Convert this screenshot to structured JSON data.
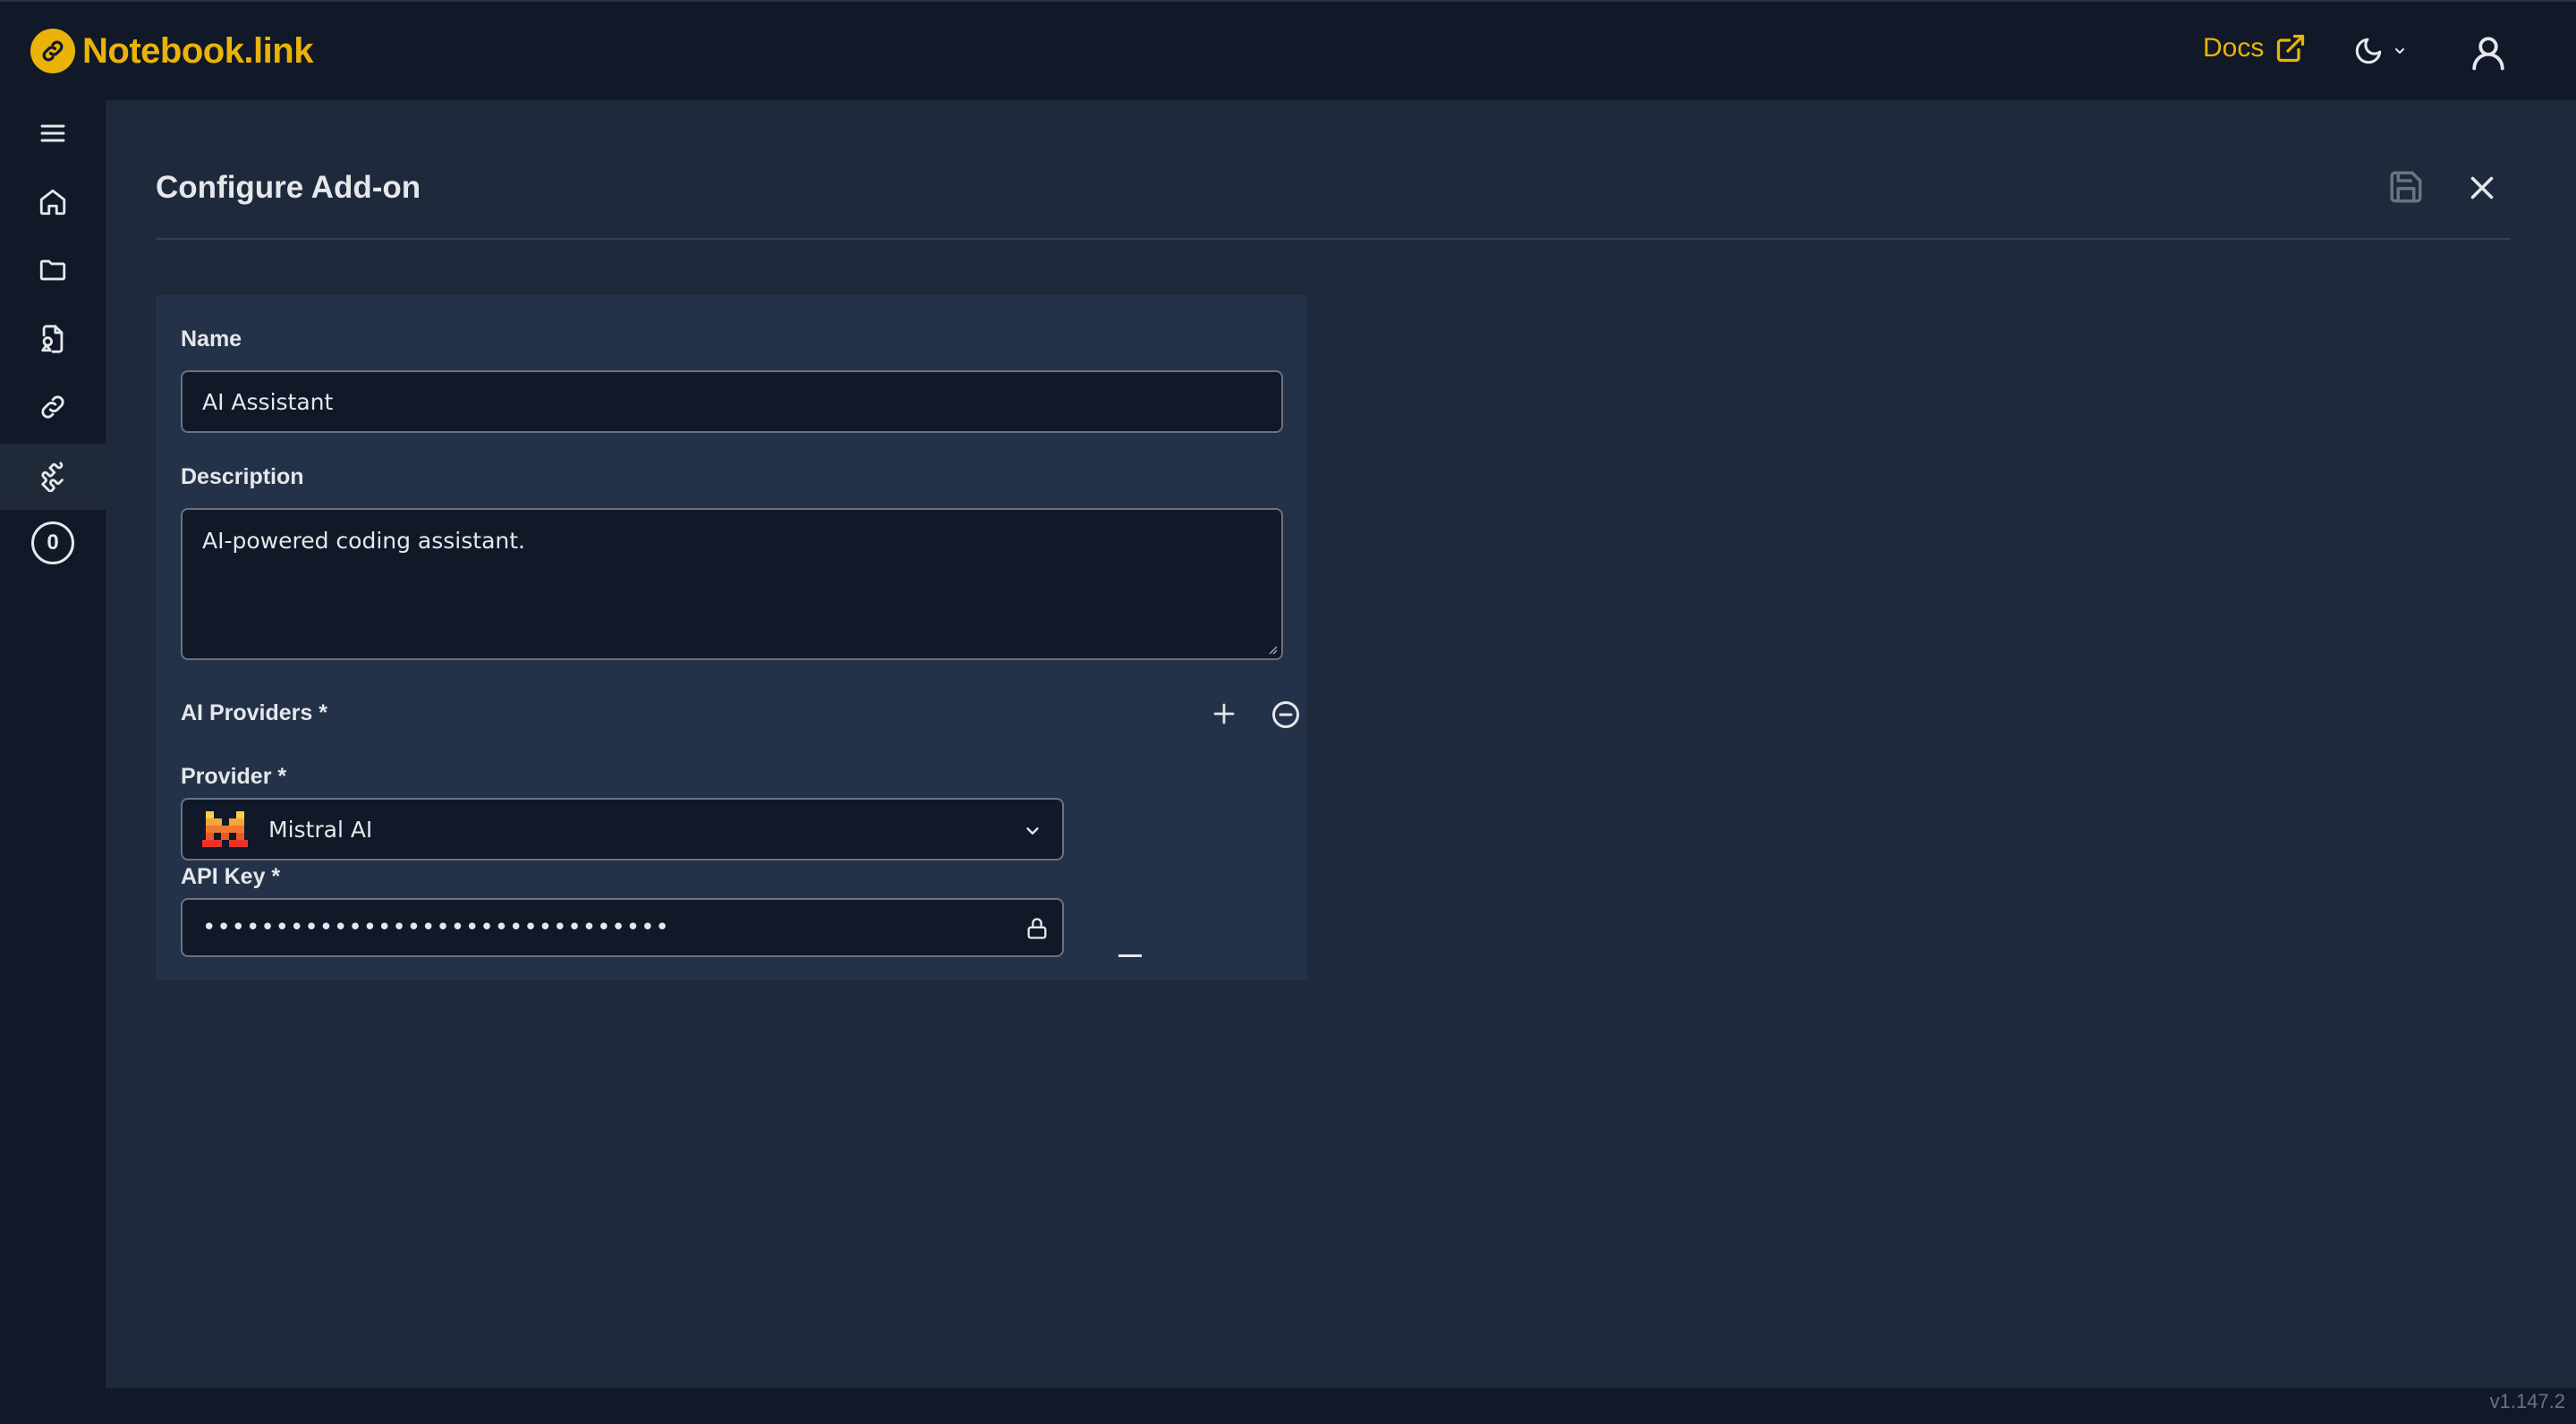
{
  "app": {
    "name": "Notebook.link",
    "version": "v1.147.2"
  },
  "header": {
    "docs_label": "Docs"
  },
  "page": {
    "title": "Configure Add-on"
  },
  "sidebar": {
    "items": [
      {
        "icon": "menu-icon"
      },
      {
        "icon": "home-icon"
      },
      {
        "icon": "folder-icon"
      },
      {
        "icon": "file-shapes-icon"
      },
      {
        "icon": "link-icon"
      },
      {
        "icon": "puzzle-icon",
        "active": true
      },
      {
        "icon": "counter-badge",
        "value": "0"
      }
    ]
  },
  "form": {
    "name_label": "Name",
    "name_value": "AI Assistant",
    "description_label": "Description",
    "description_value": "AI-powered coding assistant.",
    "providers_label": "AI Providers *",
    "provider_label": "Provider *",
    "provider_value": "Mistral AI",
    "api_key_label": "API Key *",
    "api_key_value": "••••••••••••••••••••••••••••••••"
  },
  "colors": {
    "accent": "#eab308",
    "background": "#1e293b",
    "card": "#243249",
    "input": "#111827"
  }
}
